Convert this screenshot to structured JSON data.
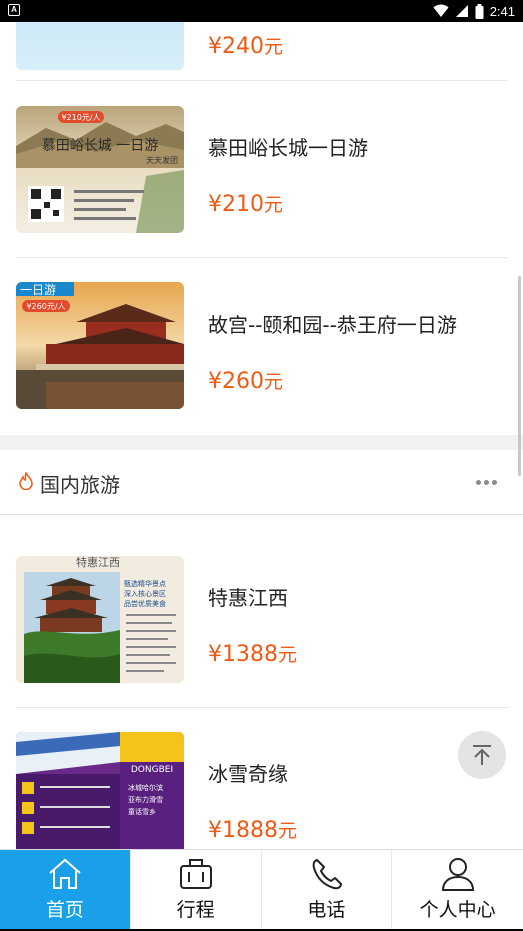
{
  "status_bar": {
    "notification_icon": "A",
    "time": "2:41",
    "icons": [
      "wifi-icon",
      "signal-icon",
      "battery-icon"
    ]
  },
  "products_top": [
    {
      "title": "",
      "price": "¥240",
      "unit": "元",
      "thumb_colors": [
        "#bfe3f5",
        "#cfeaf7"
      ]
    },
    {
      "title": "慕田峪长城一日游",
      "price": "¥210",
      "unit": "元",
      "thumb_text": [
        "慕田峪长城 一日游",
        "天天发团",
        "¥210元/人"
      ],
      "thumb_colors": [
        "#7a6a4a",
        "#d9c9a3"
      ]
    },
    {
      "title": "故宫--颐和园--恭王府一日游",
      "price": "¥260",
      "unit": "元",
      "thumb_text": [
        "一日游",
        "¥260元/人"
      ],
      "thumb_colors": [
        "#8a3a24",
        "#e0a060"
      ]
    }
  ],
  "section": {
    "title": "国内旅游",
    "icon": "flame-icon",
    "more_icon": "more-dots-icon"
  },
  "products_domestic": [
    {
      "title": "特惠江西",
      "price": "¥1388",
      "unit": "元",
      "thumb_text": [
        "特惠江西",
        "甄选精华景点",
        "深入核心景区",
        "品尝优质美食"
      ],
      "thumb_colors": [
        "#3d7a2a",
        "#f2ece0"
      ]
    },
    {
      "title": "冰雪奇缘",
      "price": "¥1888",
      "unit": "元",
      "thumb_text": [
        "DONGBEI",
        "冰城哈尔滨",
        "亚布力滑雪",
        "童话雪乡"
      ],
      "thumb_colors": [
        "#6a2a8a",
        "#f4c41a"
      ]
    }
  ],
  "back_to_top_icon": "arrow-up-icon",
  "tabs": [
    {
      "label": "首页",
      "icon": "home-icon",
      "active": true
    },
    {
      "label": "行程",
      "icon": "suitcase-icon",
      "active": false
    },
    {
      "label": "电话",
      "icon": "phone-icon",
      "active": false
    },
    {
      "label": "个人中心",
      "icon": "user-icon",
      "active": false
    }
  ],
  "colors": {
    "accent": "#1aa0e8",
    "price": "#f05a14",
    "flame": "#f05a14"
  }
}
